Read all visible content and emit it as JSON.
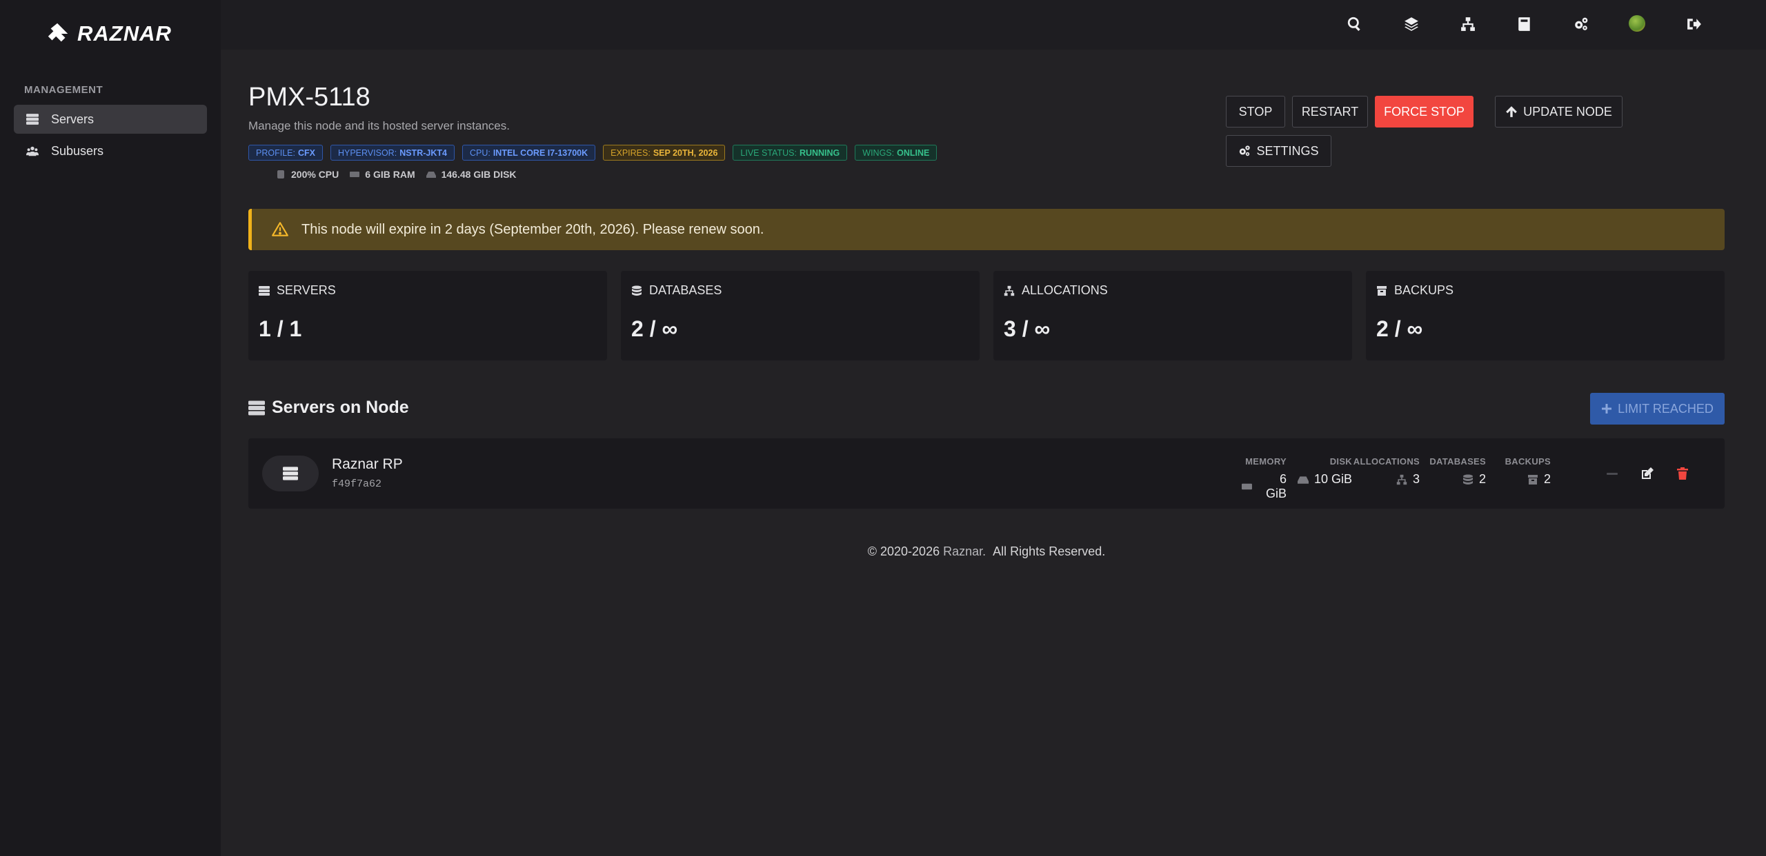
{
  "brand": {
    "name": "RAZNAR"
  },
  "sidebar": {
    "heading": "MANAGEMENT",
    "items": [
      {
        "label": "Servers",
        "icon": "server-list-icon",
        "active": true
      },
      {
        "label": "Subusers",
        "icon": "users-icon",
        "active": false
      }
    ]
  },
  "topbar": {
    "icons": [
      "search-icon",
      "layers-icon",
      "network-icon",
      "book-icon",
      "cogs-icon",
      "avatar",
      "sign-out-icon"
    ]
  },
  "header": {
    "title": "PMX-5118",
    "subtitle": "Manage this node and its hosted server instances.",
    "badges": [
      {
        "key": "PROFILE:",
        "value": "CFX",
        "color": "blue"
      },
      {
        "key": "HYPERVISOR:",
        "value": "NSTR-JKT4",
        "color": "blue"
      },
      {
        "key": "CPU:",
        "value": "INTEL CORE I7-13700K",
        "color": "blue"
      },
      {
        "key": "EXPIRES:",
        "value": "SEP 20TH, 2026",
        "color": "yellow"
      },
      {
        "key": "LIVE STATUS:",
        "value": "RUNNING",
        "color": "green"
      },
      {
        "key": "WINGS:",
        "value": "ONLINE",
        "color": "green"
      }
    ],
    "resources": [
      {
        "label": "200% CPU",
        "icon": "cpu-icon"
      },
      {
        "label": "6 GIB RAM",
        "icon": "memory-icon"
      },
      {
        "label": "146.48 GIB DISK",
        "icon": "hdd-icon"
      }
    ]
  },
  "actions": {
    "stop": "STOP",
    "restart": "RESTART",
    "force_stop": "FORCE STOP",
    "update_node": "UPDATE NODE",
    "settings": "SETTINGS"
  },
  "alert": {
    "message": "This node will expire in 2 days (September 20th, 2026). Please renew soon."
  },
  "stats": [
    {
      "label": "SERVERS",
      "value": "1 / 1",
      "icon": "server-list-icon"
    },
    {
      "label": "DATABASES",
      "value": "2 / ∞",
      "icon": "database-icon"
    },
    {
      "label": "ALLOCATIONS",
      "value": "3 / ∞",
      "icon": "network-icon"
    },
    {
      "label": "BACKUPS",
      "value": "2 / ∞",
      "icon": "archive-icon"
    }
  ],
  "servers_section": {
    "title": "Servers on Node",
    "limit_button": "LIMIT REACHED"
  },
  "servers": [
    {
      "name": "Raznar RP",
      "id": "f49f7a62",
      "memory_label": "MEMORY",
      "memory": "6 GiB",
      "disk_label": "DISK",
      "disk": "10 GiB",
      "allocations_label": "ALLOCATIONS",
      "allocations": "3",
      "databases_label": "DATABASES",
      "databases": "2",
      "backups_label": "BACKUPS",
      "backups": "2"
    }
  ],
  "footer": {
    "prefix": "© 2020-2026",
    "brand": "Raznar.",
    "suffix": "All Rights Reserved."
  },
  "colors": {
    "danger": "#f2463f",
    "warning": "#f0b21a",
    "primary": "#2f5aa8",
    "success": "#2aa879"
  }
}
